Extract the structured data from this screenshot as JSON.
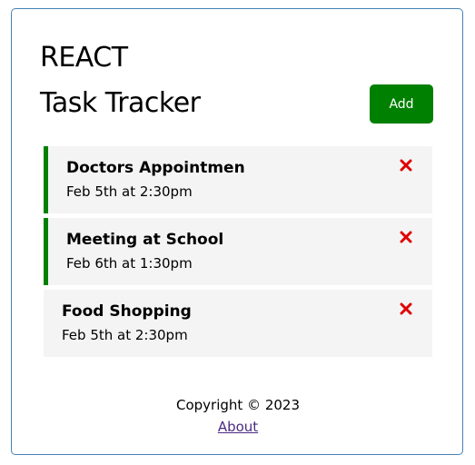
{
  "header": {
    "title_line1": "REACT",
    "title_line2": "Task Tracker",
    "add_label": "Add"
  },
  "tasks": [
    {
      "text": "Doctors Appointmen",
      "day": "Feb 5th at 2:30pm",
      "reminder": true
    },
    {
      "text": "Meeting at School",
      "day": "Feb 6th at 1:30pm",
      "reminder": true
    },
    {
      "text": "Food Shopping",
      "day": "Feb 5th at 2:30pm",
      "reminder": false
    }
  ],
  "footer": {
    "copyright": "Copyright © 2023",
    "about_link": "About"
  },
  "colors": {
    "add_button": "#008000",
    "reminder_border": "#008000",
    "delete_icon": "#e00000",
    "task_background": "#f4f4f4",
    "container_border": "#4682b4"
  },
  "icons": {
    "delete": "close-icon"
  }
}
